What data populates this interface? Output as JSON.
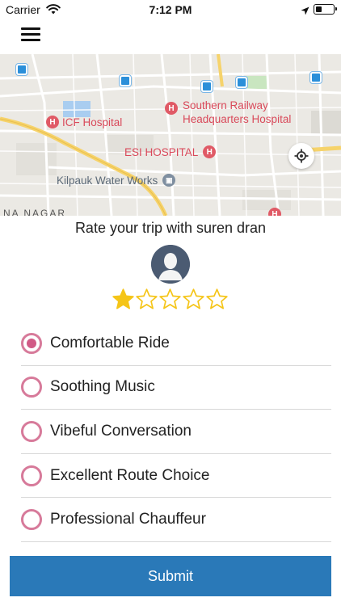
{
  "status_bar": {
    "carrier": "Carrier",
    "time": "7:12 PM",
    "icons": [
      "wifi-icon",
      "location-arrow-icon",
      "battery-icon"
    ]
  },
  "header": {
    "menu_icon": "hamburger-menu-icon"
  },
  "map": {
    "labels": {
      "southern_railway_hq": "Southern Railway Headquarters Hospital",
      "southern_railway_line1": "Southern Railway",
      "southern_railway_line2": "Headquarters Hospital",
      "icf_hospital": "ICF Hospital",
      "esi_hospital": "ESI HOSPITAL",
      "kilpauk": "Kilpauk Water Works",
      "nagar": "NA NAGAR"
    },
    "hospital_glyph": "H",
    "colors": {
      "land": "#ebe9e4",
      "road_major": "#f6d36b",
      "road_minor": "#ffffff",
      "water": "#a9cdf0",
      "park": "#c9e6c0",
      "hospital": "#e05a66",
      "metro": "#2b8fd9"
    }
  },
  "rating": {
    "title": "Rate your trip with suren dran",
    "stars_total": 5,
    "stars_selected": 1,
    "star_color": "#f5c518"
  },
  "options": [
    {
      "label": "Comfortable Ride",
      "checked": true
    },
    {
      "label": "Soothing Music",
      "checked": false
    },
    {
      "label": "Vibeful Conversation",
      "checked": false
    },
    {
      "label": "Excellent Route Choice",
      "checked": false
    },
    {
      "label": "Professional Chauffeur",
      "checked": false
    }
  ],
  "submit": {
    "label": "Submit",
    "color": "#2a79b8"
  }
}
